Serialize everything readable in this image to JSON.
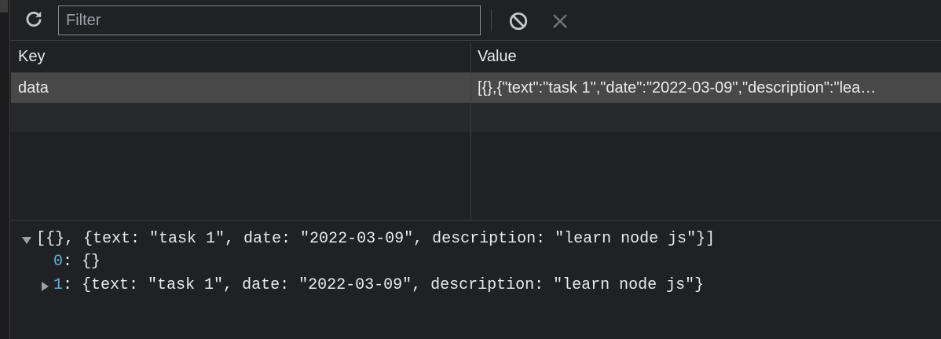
{
  "toolbar": {
    "refresh_icon": "refresh-icon",
    "filter_placeholder": "Filter",
    "filter_value": "",
    "clear_all_icon": "block-icon",
    "delete_icon": "close-icon"
  },
  "table": {
    "columns": [
      "Key",
      "Value"
    ],
    "rows": [
      {
        "key": "data",
        "value": "[{},{\"text\":\"task 1\",\"date\":\"2022-03-09\",\"description\":\"lea…"
      }
    ]
  },
  "preview": {
    "root": "[{}, {text: \"task 1\", date: \"2022-03-09\", description: \"learn node js\"}]",
    "items": [
      {
        "index": "0",
        "sep": ": ",
        "value": "{}"
      },
      {
        "index": "1",
        "sep": ": ",
        "value": "{text: \"task 1\", date: \"2022-03-09\", description: \"learn node js\"}"
      }
    ]
  },
  "colors": {
    "background": "#202124",
    "selected_row": "#484848",
    "index_blue": "#5db0d7"
  }
}
